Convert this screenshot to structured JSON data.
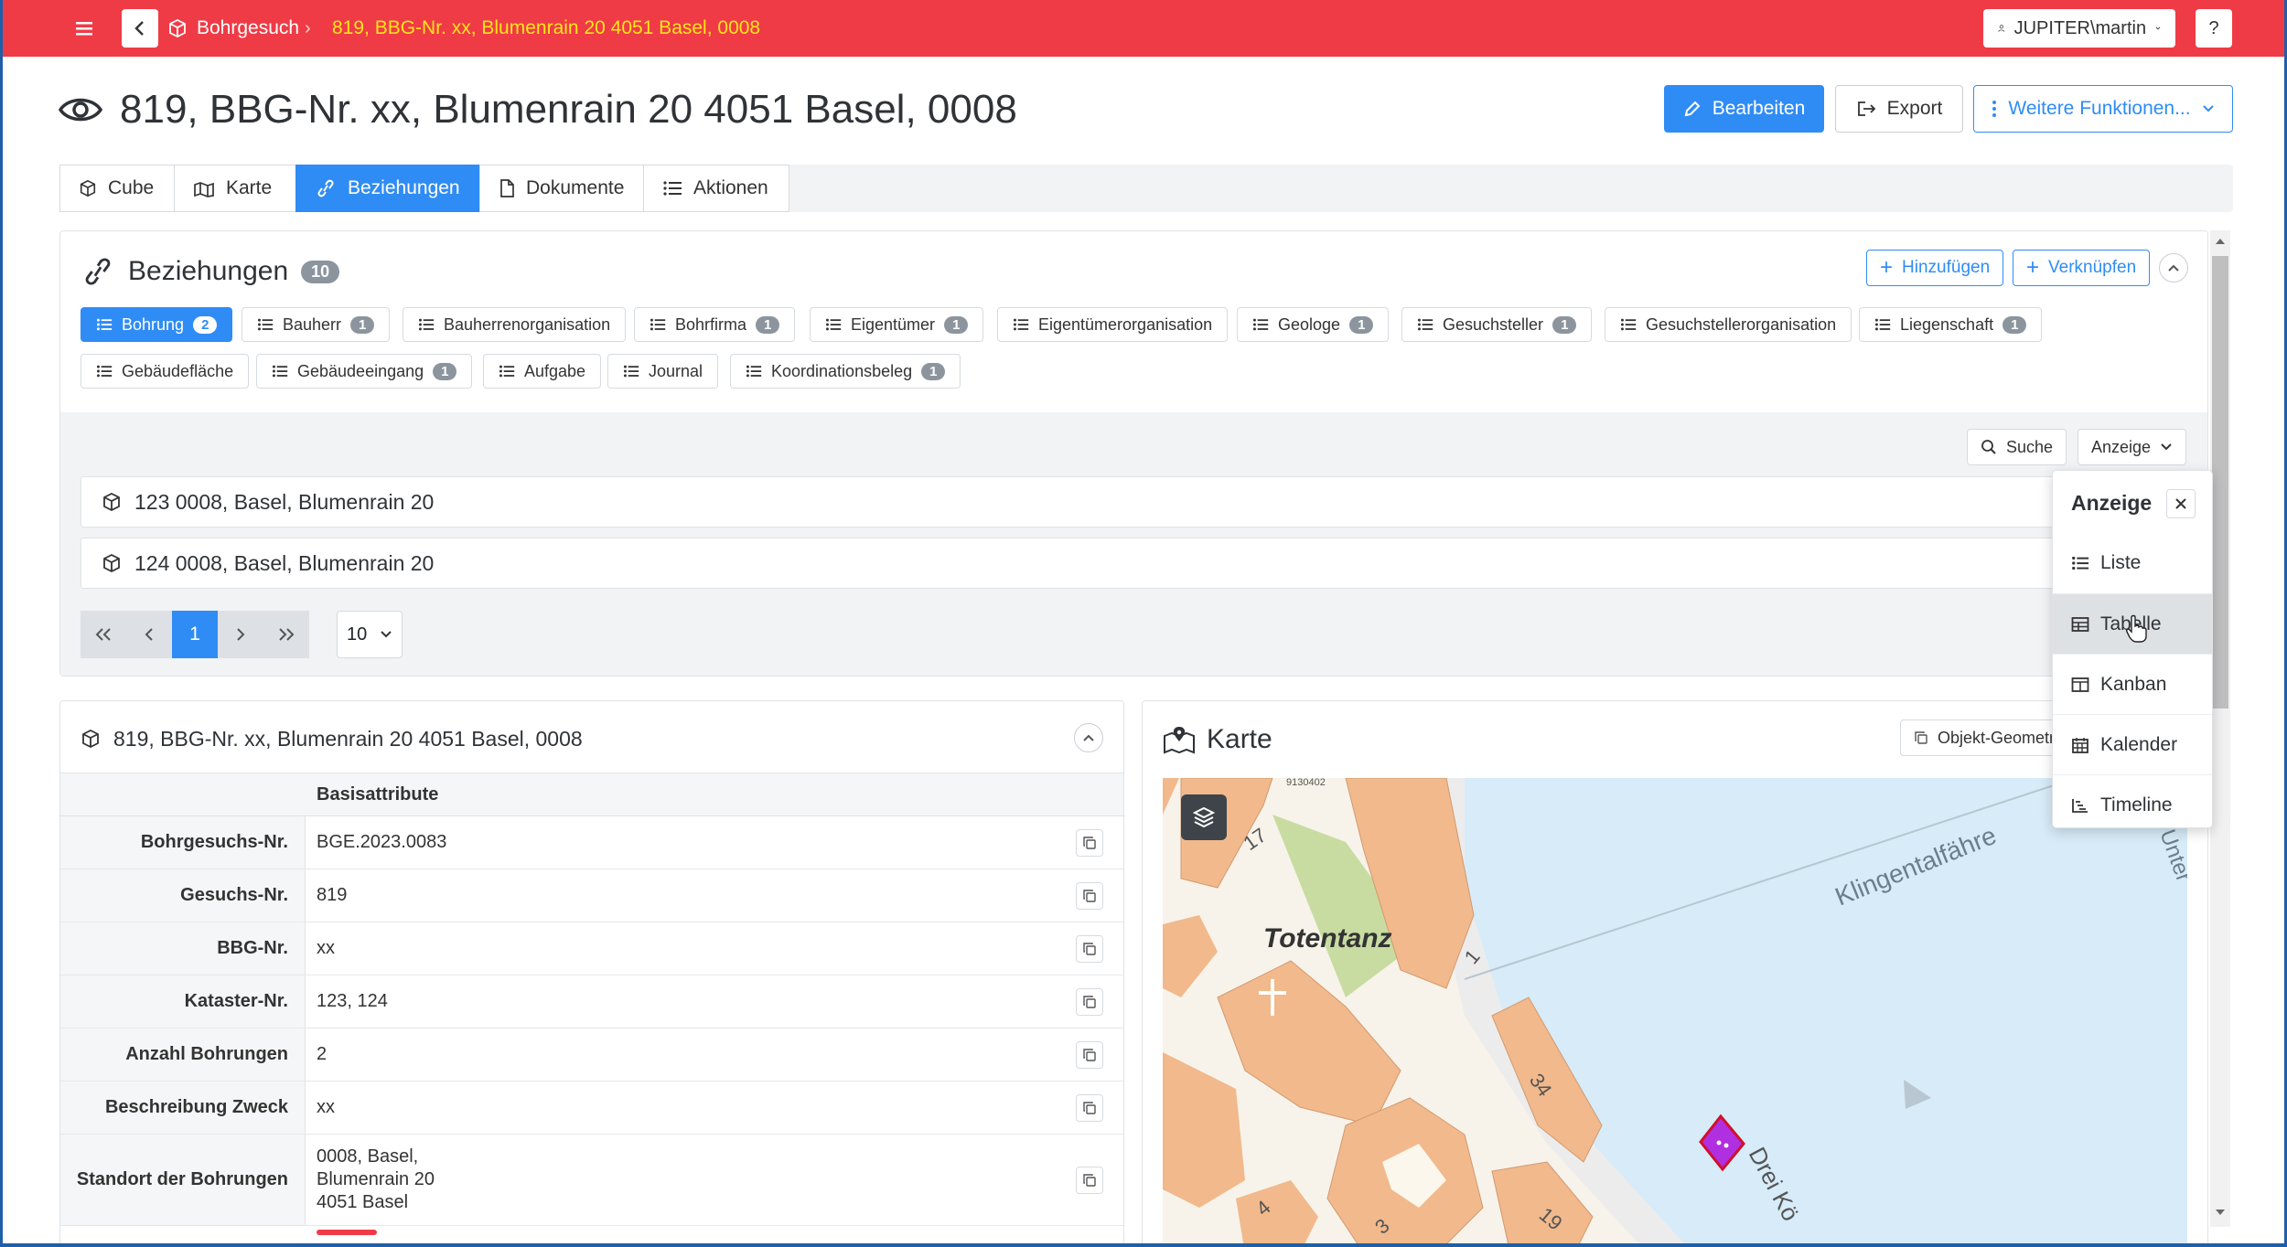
{
  "topbar": {
    "breadcrumb_root": "Bohrgesuch",
    "breadcrumb_current": "819, BBG-Nr. xx, Blumenrain 20 4051 Basel, 0008",
    "user": "JUPITER\\martin",
    "help": "?"
  },
  "header": {
    "title": "819, BBG-Nr. xx, Blumenrain 20 4051 Basel, 0008",
    "edit_label": "Bearbeiten",
    "export_label": "Export",
    "more_label": "Weitere Funktionen..."
  },
  "tabs": [
    {
      "label": "Cube"
    },
    {
      "label": "Karte"
    },
    {
      "label": "Beziehungen"
    },
    {
      "label": "Dokumente"
    },
    {
      "label": "Aktionen"
    }
  ],
  "relations": {
    "title": "Beziehungen",
    "count": "10",
    "add_label": "Hinzufügen",
    "link_label": "Verknüpfen",
    "filters": [
      {
        "label": "Bohrung",
        "count": "2"
      },
      {
        "label": "Bauherr",
        "count": "1"
      },
      {
        "label": "Bauherrenorganisation",
        "count": ""
      },
      {
        "label": "Bohrfirma",
        "count": "1"
      },
      {
        "label": "Eigentümer",
        "count": "1"
      },
      {
        "label": "Eigentümerorganisation",
        "count": ""
      },
      {
        "label": "Geologe",
        "count": "1"
      },
      {
        "label": "Gesuchsteller",
        "count": "1"
      },
      {
        "label": "Gesuchstellerorganisation",
        "count": ""
      },
      {
        "label": "Liegenschaft",
        "count": "1"
      },
      {
        "label": "Gebäudefläche",
        "count": ""
      },
      {
        "label": "Gebäudeeingang",
        "count": "1"
      },
      {
        "label": "Aufgabe",
        "count": ""
      },
      {
        "label": "Journal",
        "count": ""
      },
      {
        "label": "Koordinationsbeleg",
        "count": "1"
      }
    ],
    "search_label": "Suche",
    "view_label": "Anzeige",
    "items": [
      {
        "label": "123 0008, Basel, Blumenrain 20"
      },
      {
        "label": "124 0008, Basel, Blumenrain 20"
      }
    ],
    "page": "1",
    "page_size": "10"
  },
  "view_menu": {
    "title": "Anzeige",
    "options": [
      {
        "label": "Liste",
        "icon": "list-icon"
      },
      {
        "label": "Tabelle",
        "icon": "table-icon"
      },
      {
        "label": "Kanban",
        "icon": "kanban-icon"
      },
      {
        "label": "Kalender",
        "icon": "calendar-icon"
      },
      {
        "label": "Timeline",
        "icon": "timeline-icon"
      }
    ]
  },
  "details": {
    "title": "819, BBG-Nr. xx, Blumenrain 20 4051 Basel, 0008",
    "section": "Basisattribute",
    "rows": [
      {
        "label": "Bohrgesuchs-Nr.",
        "value": "BGE.2023.0083"
      },
      {
        "label": "Gesuchs-Nr.",
        "value": "819"
      },
      {
        "label": "BBG-Nr.",
        "value": "xx"
      },
      {
        "label": "Kataster-Nr.",
        "value": "123, 124"
      },
      {
        "label": "Anzahl Bohrungen",
        "value": "2"
      },
      {
        "label": "Beschreibung Zweck",
        "value": "xx"
      },
      {
        "label": "Standort der Bohrungen",
        "value_lines": [
          "0008, Basel,",
          "Blumenrain 20",
          "4051 Basel"
        ]
      }
    ]
  },
  "map": {
    "title": "Karte",
    "object_button": "Objekt-Geometrie",
    "labels": {
      "place": "Totentanz",
      "river_street": "Klingentalfähre",
      "street_partial": "Drei Kö",
      "edge_label": "Unter",
      "point_label": "9130402",
      "nums": [
        "17",
        "1",
        "34",
        "4",
        "3",
        "19"
      ]
    }
  }
}
